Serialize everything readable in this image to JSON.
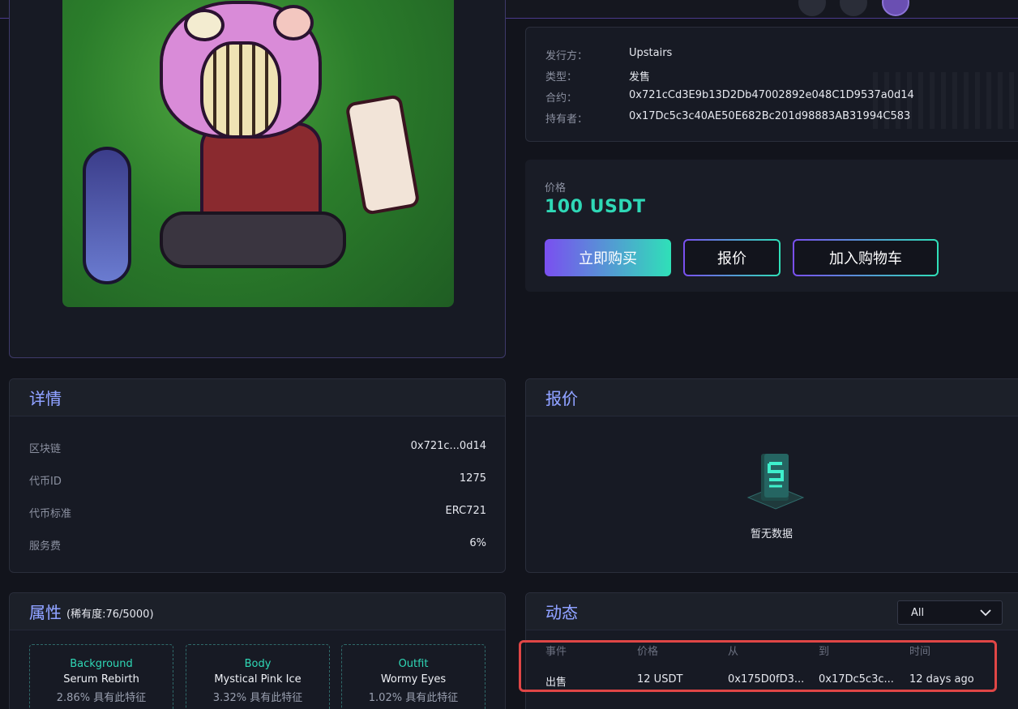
{
  "info": {
    "rows": [
      {
        "label": "发行方：",
        "value": "Upstairs"
      },
      {
        "label": "类型：",
        "value": "发售"
      },
      {
        "label": "合约：",
        "value": "0x721cCd3E9b13D2Db47002892e048C1D9537a0d14"
      },
      {
        "label": "持有者：",
        "value": "0x17Dc5c3c40AE50E682Bc201d98883AB31994C583"
      }
    ]
  },
  "price": {
    "label": "价格",
    "value": "100 USDT",
    "buy_label": "立即购买",
    "offer_label": "报价",
    "cart_label": "加入购物车"
  },
  "details": {
    "title": "详情",
    "rows": [
      {
        "label": "区块链",
        "value": "0x721c...0d14"
      },
      {
        "label": "代币ID",
        "value": "1275"
      },
      {
        "label": "代币标准",
        "value": "ERC721"
      },
      {
        "label": "服务费",
        "value": "6%"
      }
    ]
  },
  "offers": {
    "title": "报价",
    "empty_text": "暂无数据"
  },
  "traits": {
    "title": "属性",
    "subtitle": "(稀有度:76/5000)",
    "items": [
      {
        "type": "Background",
        "value": "Serum Rebirth",
        "rarity": "2.86% 具有此特征"
      },
      {
        "type": "Body",
        "value": "Mystical Pink Ice",
        "rarity": "3.32% 具有此特征"
      },
      {
        "type": "Outfit",
        "value": "Wormy Eyes",
        "rarity": "1.02% 具有此特征"
      }
    ]
  },
  "activity": {
    "title": "动态",
    "filter": "All",
    "columns": [
      "事件",
      "价格",
      "从",
      "到",
      "时间"
    ],
    "rows": [
      {
        "event": "出售",
        "price": "12 USDT",
        "from": "0x175D0fD3...",
        "to": "0x17Dc5c3c...",
        "time": "12 days ago"
      }
    ]
  },
  "colors": {
    "accent_teal": "#2fd8b6",
    "accent_purple": "#7a4ff0",
    "highlight_red": "#e04646"
  }
}
